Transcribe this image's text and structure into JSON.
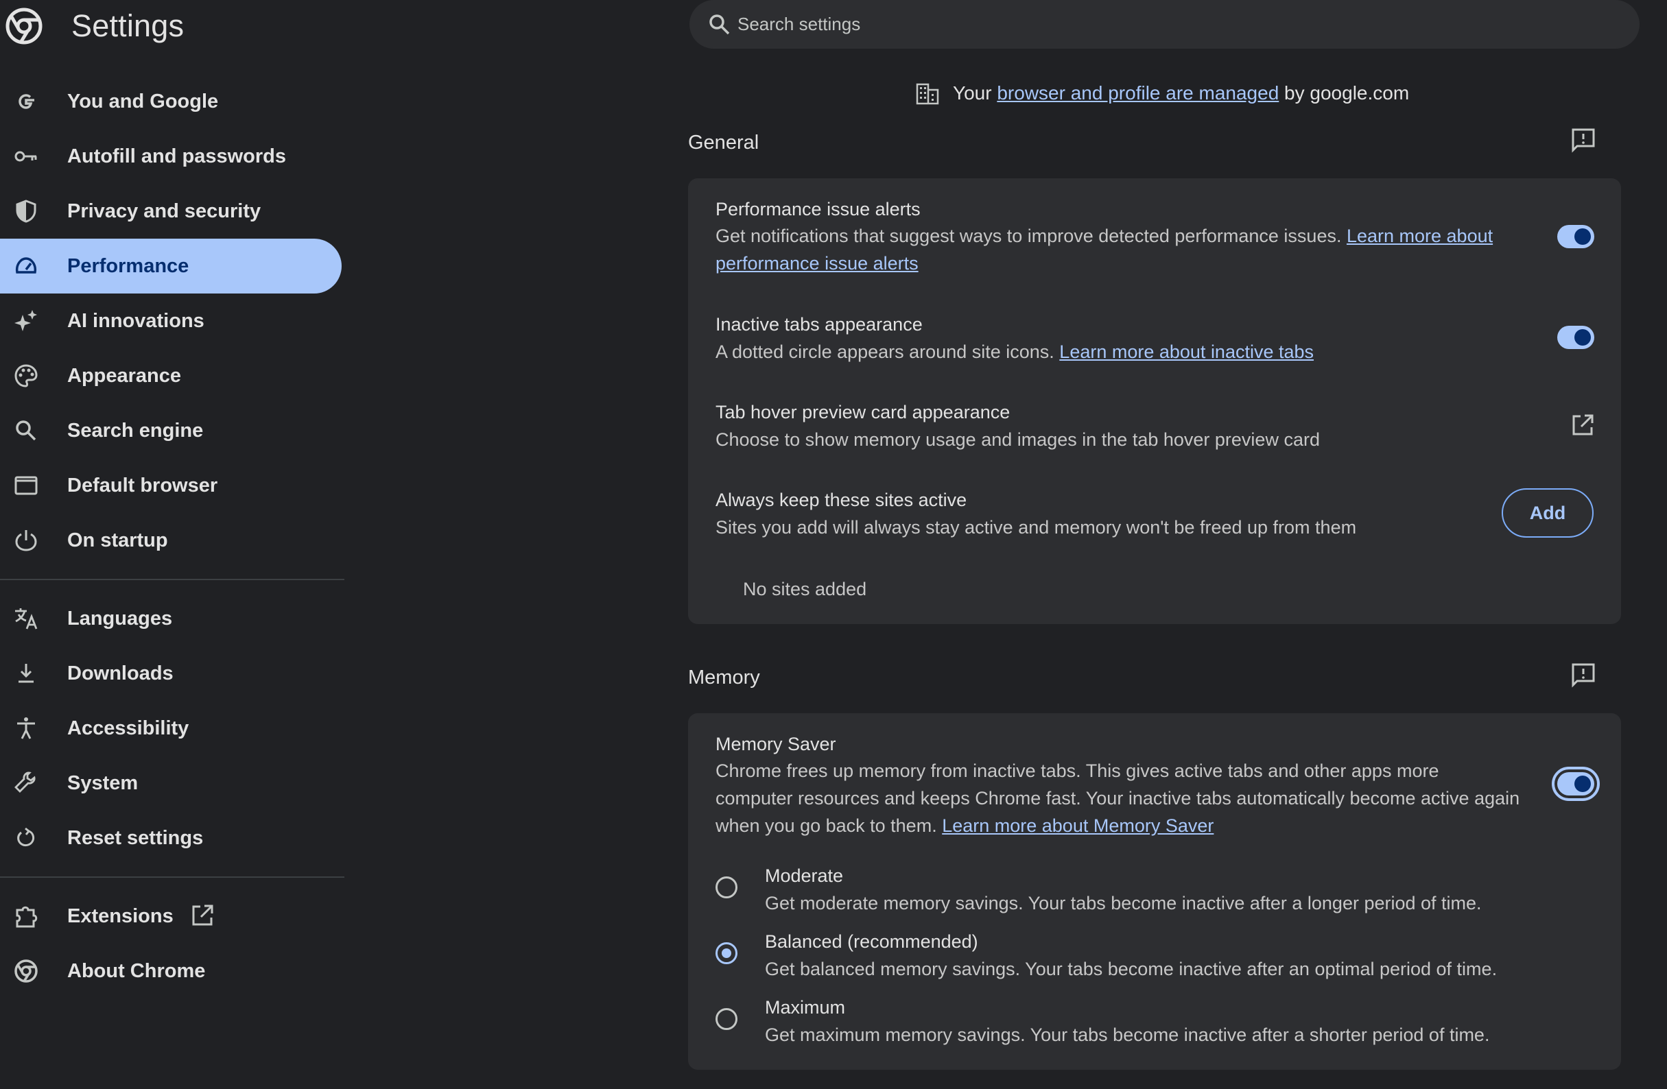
{
  "app": {
    "title": "Settings"
  },
  "sidebar": {
    "items": [
      {
        "label": "You and Google",
        "icon": "google-g-icon"
      },
      {
        "label": "Autofill and passwords",
        "icon": "key-icon"
      },
      {
        "label": "Privacy and security",
        "icon": "shield-icon"
      },
      {
        "label": "Performance",
        "icon": "speedometer-icon",
        "active": true
      },
      {
        "label": "AI innovations",
        "icon": "sparkle-icon"
      },
      {
        "label": "Appearance",
        "icon": "palette-icon"
      },
      {
        "label": "Search engine",
        "icon": "search-icon"
      },
      {
        "label": "Default browser",
        "icon": "browser-window-icon"
      },
      {
        "label": "On startup",
        "icon": "power-icon"
      },
      {
        "label": "Languages",
        "icon": "translate-icon"
      },
      {
        "label": "Downloads",
        "icon": "download-icon"
      },
      {
        "label": "Accessibility",
        "icon": "accessibility-icon"
      },
      {
        "label": "System",
        "icon": "wrench-icon"
      },
      {
        "label": "Reset settings",
        "icon": "reset-icon"
      },
      {
        "label": "Extensions",
        "icon": "puzzle-icon"
      },
      {
        "label": "About Chrome",
        "icon": "chrome-icon"
      }
    ]
  },
  "search": {
    "placeholder": "Search settings",
    "value": ""
  },
  "managed_notice": {
    "prefix": "Your ",
    "link": "browser and profile are managed",
    "suffix": " by google.com"
  },
  "general": {
    "title": "General",
    "performance_alerts": {
      "title": "Performance issue alerts",
      "desc": "Get notifications that suggest ways to improve detected performance issues. ",
      "link_part1": "Learn more about",
      "link_part2": "performance issue alerts",
      "enabled": true
    },
    "inactive_tabs": {
      "title": "Inactive tabs appearance",
      "desc": "A dotted circle appears around site icons. ",
      "link": "Learn more about inactive tabs",
      "enabled": true
    },
    "tab_hover": {
      "title": "Tab hover preview card appearance",
      "desc": "Choose to show memory usage and images in the tab hover preview card"
    },
    "keep_active": {
      "title": "Always keep these sites active",
      "desc": "Sites you add will always stay active and memory won't be freed up from them",
      "add_label": "Add",
      "empty_text": "No sites added"
    }
  },
  "memory": {
    "title": "Memory",
    "memory_saver": {
      "title": "Memory Saver",
      "desc_line1": "Chrome frees up memory from inactive tabs. This gives active tabs and other apps more",
      "desc_line2": "computer resources and keeps Chrome fast. Your inactive tabs automatically become active again",
      "desc_line3": "when you go back to them. ",
      "link": "Learn more about Memory Saver",
      "enabled": true
    },
    "options": [
      {
        "title": "Moderate",
        "desc": "Get moderate memory savings. Your tabs become inactive after a longer period of time.",
        "checked": false
      },
      {
        "title": "Balanced (recommended)",
        "desc": "Get balanced memory savings. Your tabs become inactive after an optimal period of time.",
        "checked": true
      },
      {
        "title": "Maximum",
        "desc": "Get maximum memory savings. Your tabs become inactive after a shorter period of time.",
        "checked": false
      }
    ]
  },
  "colors": {
    "background": "#202124",
    "card": "#2d2e31",
    "accent": "#a8c7fa",
    "active_text": "#062e6f"
  }
}
